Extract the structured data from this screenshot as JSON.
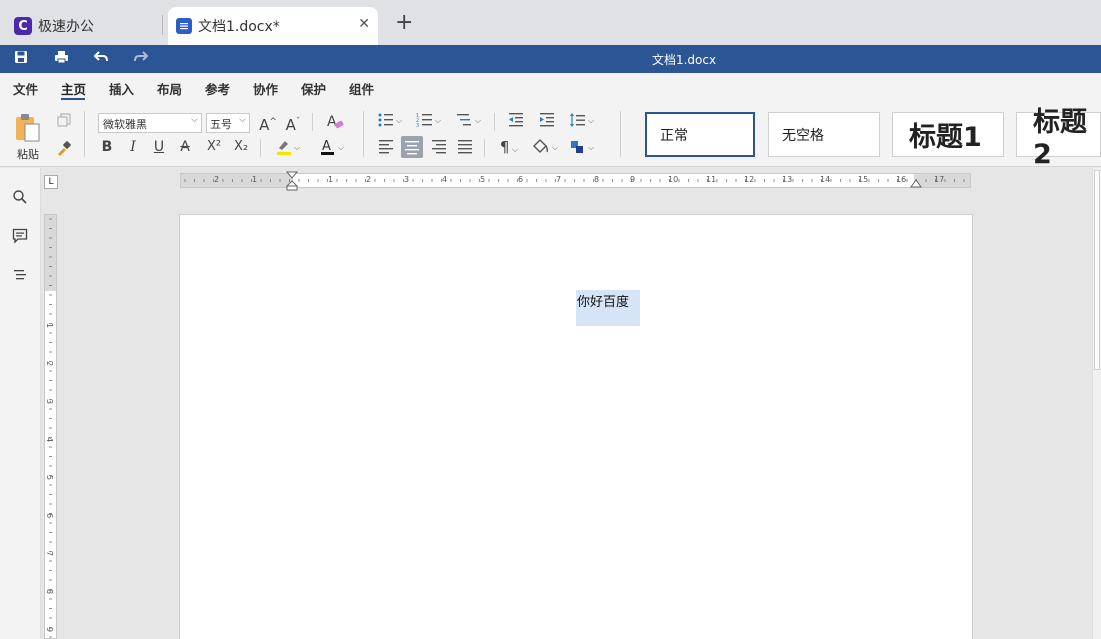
{
  "tabs": {
    "app_logo_letter": "C",
    "app_label": "极速办公",
    "doc_label": "文档1.docx*",
    "close_glyph": "✕",
    "add_glyph": "+"
  },
  "titlebar": {
    "document_title": "文档1.docx",
    "quick_access_icons": [
      "save-icon",
      "print-icon",
      "undo-icon",
      "redo-icon"
    ]
  },
  "menu": {
    "items": [
      "文件",
      "主页",
      "插入",
      "布局",
      "参考",
      "协作",
      "保护",
      "组件"
    ],
    "active": "主页"
  },
  "ribbon": {
    "paste_label": "粘贴",
    "font_name": "微软雅黑",
    "font_size": "五号",
    "styles": [
      "正常",
      "无空格",
      "标题1",
      "标题2"
    ],
    "format_glyphs": {
      "bold": "B",
      "italic": "I",
      "underline": "U",
      "strike": "A",
      "superscript": "X²",
      "subscript": "X₂",
      "grow": "A^",
      "shrink": "Aˇ",
      "font_color": "A",
      "pilcrow": "¶"
    }
  },
  "rulers": {
    "corner_glyph": "L",
    "h_labels": [
      "2",
      "1",
      "1",
      "2",
      "3",
      "4",
      "5",
      "6",
      "7",
      "8",
      "9",
      "10",
      "11",
      "12",
      "13",
      "14",
      "15",
      "16",
      "17"
    ],
    "v_labels": [
      "1",
      "2",
      "3",
      "4",
      "5",
      "6",
      "7",
      "8",
      "9"
    ]
  },
  "document": {
    "body_text": "你好百度"
  },
  "colors": {
    "accent": "#2c5596",
    "selection": "#d6e4f7",
    "highlight_yellow": "#f5e300"
  }
}
